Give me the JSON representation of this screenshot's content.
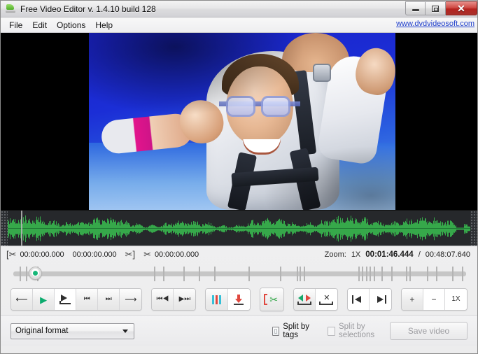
{
  "window": {
    "title": "Free Video Editor v. 1.4.10 build 128",
    "app_icon": "video-editor-icon",
    "minimize_label": "–",
    "maximize_label": "□",
    "close_label": "✕"
  },
  "menu": {
    "items": [
      {
        "label": "File"
      },
      {
        "label": "Edit"
      },
      {
        "label": "Options"
      },
      {
        "label": "Help"
      }
    ],
    "weblink": "www.dvdvideosoft.com"
  },
  "preview": {
    "alt": "skydiving tandem jumpers in blue sky"
  },
  "timecodes": {
    "selection_start_icon": "cut-start-icon",
    "selection_start": "00:00:00.000",
    "selection_length": "00:00:00.000",
    "selection_end_icon": "cut-end-icon",
    "marker_icon": "cut-marker-icon",
    "marker_value": "00:00:00.000",
    "zoom_label": "Zoom:",
    "zoom_value": "1X",
    "current_time": "00:01:46.444",
    "time_divider": "/",
    "total_time": "00:48:07.640"
  },
  "toolbar": {
    "groups": [
      {
        "name": "transport",
        "buttons": [
          {
            "name": "step-back-button",
            "icon": "arrow-left-icon",
            "glyph": "←"
          },
          {
            "name": "play-button",
            "icon": "play-icon",
            "glyph": "▶"
          },
          {
            "name": "play-from-marker-button",
            "icon": "play-from-marker-icon",
            "glyph": ""
          },
          {
            "name": "previous-marker-button",
            "icon": "skip-to-start-icon",
            "glyph": "❘◀"
          },
          {
            "name": "next-marker-button",
            "icon": "skip-to-end-icon",
            "glyph": "▶❘"
          },
          {
            "name": "step-forward-button",
            "icon": "arrow-right-icon",
            "glyph": "→"
          }
        ]
      },
      {
        "name": "jump",
        "buttons": [
          {
            "name": "jump-to-begin-button",
            "icon": "rewind-to-begin-icon",
            "glyph": "⏮"
          },
          {
            "name": "jump-to-end-button",
            "icon": "forward-to-end-icon",
            "glyph": "⏭"
          }
        ]
      },
      {
        "name": "markers",
        "buttons": [
          {
            "name": "add-marker-button",
            "icon": "marker-bars-icon",
            "glyph": ""
          },
          {
            "name": "insert-marker-button",
            "icon": "insert-down-arrow-icon",
            "glyph": ""
          }
        ]
      },
      {
        "name": "cut",
        "buttons": [
          {
            "name": "cut-selection-button",
            "icon": "bracket-scissors-icon",
            "glyph": ""
          }
        ]
      },
      {
        "name": "segments",
        "buttons": [
          {
            "name": "merge-segments-button",
            "icon": "merge-arrows-icon",
            "glyph": ""
          },
          {
            "name": "delete-segment-button",
            "icon": "delete-segment-icon",
            "glyph": ""
          }
        ]
      },
      {
        "name": "inout",
        "buttons": [
          {
            "name": "set-in-point-button",
            "icon": "set-in-point-icon",
            "glyph": ""
          },
          {
            "name": "set-out-point-button",
            "icon": "set-out-point-icon",
            "glyph": ""
          }
        ]
      },
      {
        "name": "zoom",
        "buttons": [
          {
            "name": "zoom-in-button",
            "icon": "plus-icon",
            "glyph": "+"
          },
          {
            "name": "zoom-out-button",
            "icon": "minus-icon",
            "glyph": "−"
          },
          {
            "name": "zoom-reset-button",
            "icon": "zoom-level-icon",
            "glyph": "1X"
          }
        ]
      }
    ]
  },
  "bottom": {
    "format_value": "Original format",
    "split_by_tags_label": "Split by tags",
    "split_by_tags_checked": false,
    "split_by_selections_label": "Split by selections",
    "split_by_selections_checked": false,
    "split_by_selections_disabled": true,
    "save_video_label": "Save video",
    "save_video_disabled": true
  },
  "colors": {
    "accent_green": "#15b778",
    "waveform_green": "#36a84a",
    "close_red": "#b5241f",
    "link_blue": "#1f3fcc",
    "cut_red": "#e0483f",
    "panel_dark": "#26282b"
  },
  "seek": {
    "position_percent": 3.5,
    "tick_positions": [
      1.5,
      3.0,
      5.6,
      33.0,
      35.2,
      40.0,
      43.6,
      47.2,
      55.2,
      62.6,
      68.2,
      66.5,
      67.2,
      81.0,
      81.9,
      82.8,
      83.7,
      84.7,
      86.4,
      88.8,
      92.2,
      93.0,
      97.2,
      99.2,
      103.0,
      105.4
    ]
  }
}
